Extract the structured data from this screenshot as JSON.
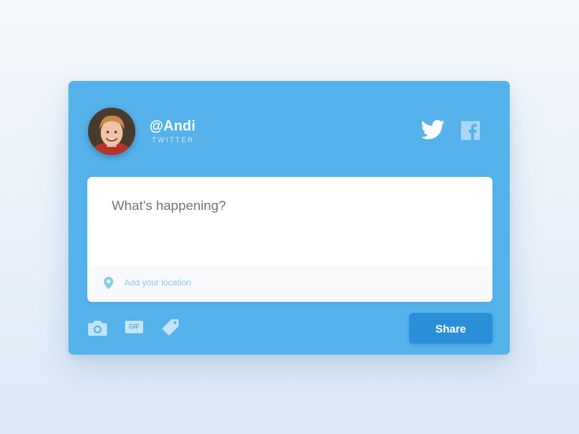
{
  "profile": {
    "username": "@Andi",
    "network": "TWITTER"
  },
  "social": {
    "icons": [
      "twitter-icon",
      "facebook-icon"
    ]
  },
  "compose": {
    "placeholder": "What’s happening?",
    "value": "",
    "location_label": "Add your location"
  },
  "toolbar": {
    "icons": [
      "camera-icon",
      "gif-icon",
      "tag-icon"
    ],
    "gif_label": "GIF",
    "share_label": "Share"
  },
  "colors": {
    "card": "#55b2ea",
    "share_button": "#2a8fd6",
    "accent_light": "#c4e4f8"
  }
}
